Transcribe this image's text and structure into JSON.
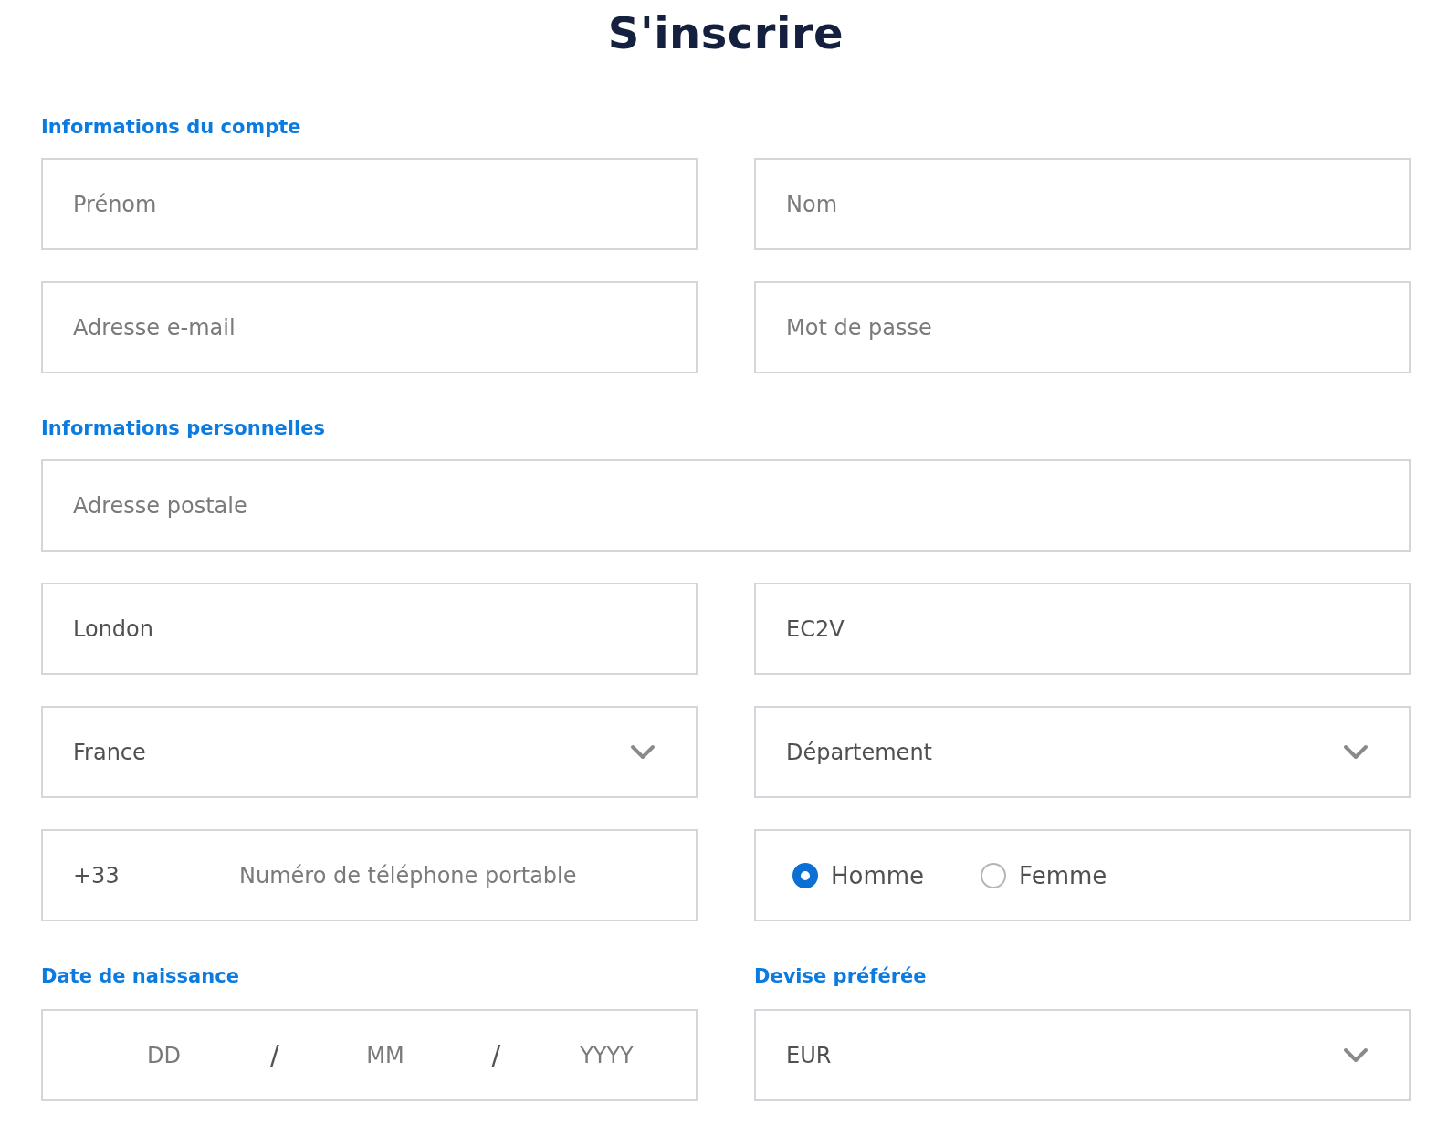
{
  "title": "S'inscrire",
  "account": {
    "heading": "Informations du compte",
    "fields": [
      {
        "placeholder": "Prénom"
      },
      {
        "placeholder": "Nom"
      },
      {
        "placeholder": "Adresse e-mail"
      },
      {
        "placeholder": "Mot de passe"
      }
    ]
  },
  "personal": {
    "heading": "Informations personnelles",
    "address": {
      "placeholder": "Adresse postale"
    },
    "city": {
      "value": "London"
    },
    "postcode": {
      "value": "EC2V"
    },
    "country": {
      "value": "France"
    },
    "department": {
      "value": "Département"
    },
    "phone": {
      "code": "+33",
      "placeholder": "Numéro de téléphone portable"
    },
    "gender": [
      {
        "label": "Homme",
        "selected": true
      },
      {
        "label": "Femme",
        "selected": false
      }
    ]
  },
  "birth_date": {
    "heading": "Date de naissance",
    "parts": [
      {
        "placeholder": "DD"
      },
      {
        "placeholder": "MM"
      },
      {
        "placeholder": "YYYY"
      }
    ],
    "separators": [
      "/",
      "/"
    ]
  },
  "currency": {
    "heading": "Devise préférée",
    "value": "EUR"
  }
}
